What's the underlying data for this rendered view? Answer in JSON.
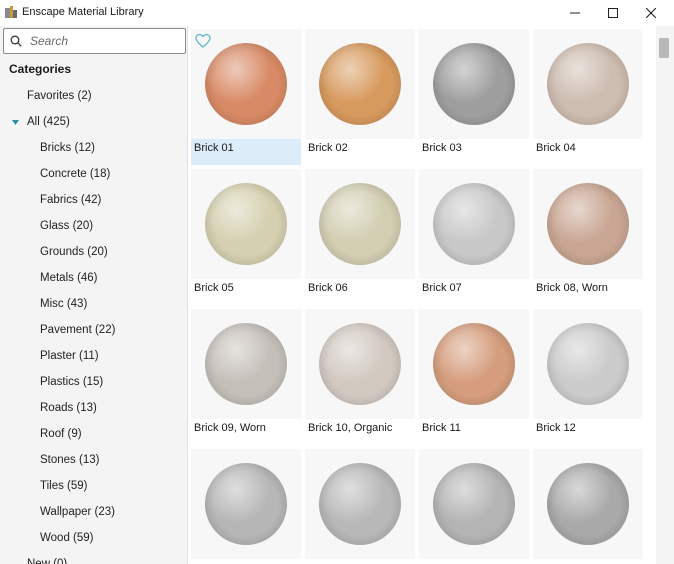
{
  "window": {
    "title": "Enscape Material Library"
  },
  "search": {
    "placeholder": "Search"
  },
  "sidebar": {
    "heading": "Categories",
    "favorites": "Favorites (2)",
    "all": "All (425)",
    "items": [
      "Bricks (12)",
      "Concrete (18)",
      "Fabrics (42)",
      "Glass (20)",
      "Grounds (20)",
      "Metals (46)",
      "Misc (43)",
      "Pavement (22)",
      "Plaster (11)",
      "Plastics (15)",
      "Roads (13)",
      "Roof (9)",
      "Stones (13)",
      "Tiles (59)",
      "Wallpaper (23)",
      "Wood (59)"
    ],
    "new": "New (0)"
  },
  "materials": [
    {
      "name": "Brick 01",
      "color": "#d88a66",
      "selected": true
    },
    {
      "name": "Brick 02",
      "color": "#d79a5e",
      "selected": false
    },
    {
      "name": "Brick 03",
      "color": "#9e9e9e",
      "selected": false
    },
    {
      "name": "Brick 04",
      "color": "#cdbcb0",
      "selected": false
    },
    {
      "name": "Brick 05",
      "color": "#d5d0b0",
      "selected": false
    },
    {
      "name": "Brick 06",
      "color": "#d2ceb2",
      "selected": false
    },
    {
      "name": "Brick 07",
      "color": "#c8c8c8",
      "selected": false
    },
    {
      "name": "Brick 08, Worn",
      "color": "#c9a693",
      "selected": false
    },
    {
      "name": "Brick 09, Worn",
      "color": "#c5bfb9",
      "selected": false
    },
    {
      "name": "Brick 10, Organic",
      "color": "#d2c9c1",
      "selected": false
    },
    {
      "name": "Brick 11",
      "color": "#d59d7d",
      "selected": false
    },
    {
      "name": "Brick 12",
      "color": "#cbcbcb",
      "selected": false
    },
    {
      "name": "",
      "color": "#b6b6b6",
      "selected": false
    },
    {
      "name": "",
      "color": "#b8b8b8",
      "selected": false
    },
    {
      "name": "",
      "color": "#b4b4b4",
      "selected": false
    },
    {
      "name": "",
      "color": "#a9a9a9",
      "selected": false
    }
  ],
  "colors": {
    "selection": "#dcecf8",
    "favorite_icon": "#5fb7c8"
  }
}
